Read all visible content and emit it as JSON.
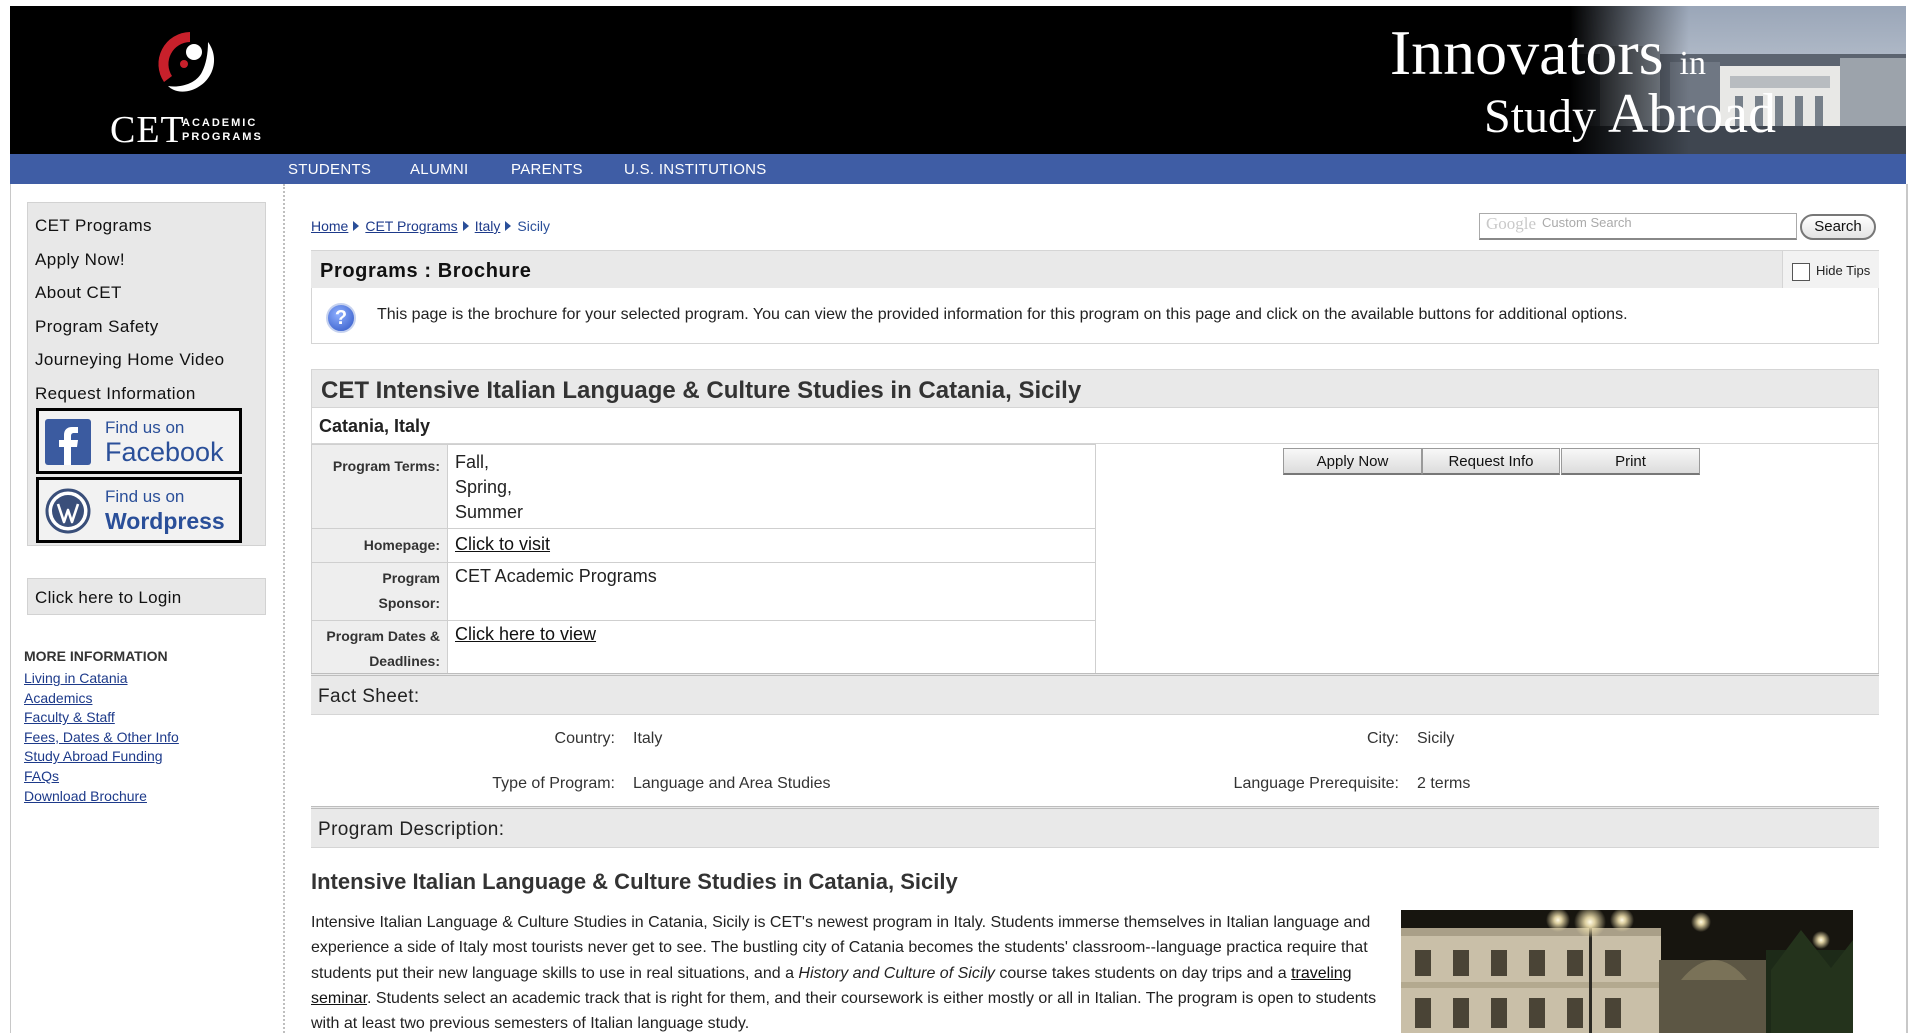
{
  "header": {
    "logo": {
      "name": "CET",
      "sub_line1": "ACADEMIC",
      "sub_line2": "PROGRAMS"
    },
    "slogan": {
      "w1": "Innovators",
      "w2": "in",
      "w3": "Study",
      "w4": "Abroad"
    }
  },
  "nav": [
    "STUDENTS",
    "ALUMNI",
    "PARENTS",
    "U.S. INSTITUTIONS"
  ],
  "sidebar": {
    "menu": [
      "CET Programs",
      "Apply Now!",
      "About CET",
      "Program Safety",
      "Journeying Home Video",
      "Request Information"
    ],
    "facebook": {
      "line1": "Find us on",
      "line2": "Facebook"
    },
    "wordpress": {
      "line1": "Find us on",
      "line2": "Wordpress"
    },
    "login": "Click here to Login",
    "more_info_title": "MORE INFORMATION",
    "more_info_links": [
      "Living in Catania",
      "Academics",
      "Faculty & Staff",
      "Fees, Dates & Other Info",
      "Study Abroad Funding",
      "FAQs",
      "Download Brochure"
    ]
  },
  "breadcrumb": [
    "Home",
    "CET Programs",
    "Italy",
    "Sicily"
  ],
  "search": {
    "brand": "Google",
    "placeholder": "Custom Search",
    "button": "Search"
  },
  "programs_bar": {
    "title": "Programs : Brochure",
    "hide_tips": "Hide Tips"
  },
  "tip": {
    "icon": "?",
    "text": "This page is the brochure for your selected program. You can view the provided information for this program on this page and click on the available buttons for additional options."
  },
  "program": {
    "title": "CET Intensive Italian Language & Culture Studies in Catania, Sicily",
    "location": "Catania, Italy",
    "terms_label": "Program Terms:",
    "terms": [
      "Fall,",
      "Spring,",
      "Summer"
    ],
    "homepage_label": "Homepage:",
    "homepage_link": "Click to visit",
    "sponsor_label_1": "Program",
    "sponsor_label_2": "Sponsor:",
    "sponsor": "CET Academic Programs",
    "dates_label_1": "Program Dates &",
    "dates_label_2": "Deadlines:",
    "dates_link": "Click here to view"
  },
  "actions": [
    "Apply Now",
    "Request Info",
    "Print"
  ],
  "fact_sheet": {
    "title": "Fact Sheet:",
    "country_label": "Country:",
    "country": "Italy",
    "city_label": "City:",
    "city": "Sicily",
    "type_label": "Type of Program:",
    "type": "Language and Area Studies",
    "prereq_label": "Language Prerequisite:",
    "prereq": "2 terms"
  },
  "description": {
    "section_title": "Program Description:",
    "heading": "Intensive Italian Language & Culture Studies in Catania, Sicily",
    "p1": "Intensive Italian Language & Culture Studies in Catania, Sicily is CET's newest program in Italy. Students immerse themselves in Italian language and experience a side of Italy most tourists never get to see. The bustling city of Catania becomes the students' classroom--language practica require that students put their new language skills to use in real situations, and a ",
    "p1_italic": "History and Culture of Sicily",
    "p2": " course takes students on day trips and a ",
    "link": "traveling seminar",
    "p3": ". Students select an academic track that is right for them, and their coursework is either mostly or all in Italian. The program is open to students with at least two previous semesters of Italian language study."
  }
}
